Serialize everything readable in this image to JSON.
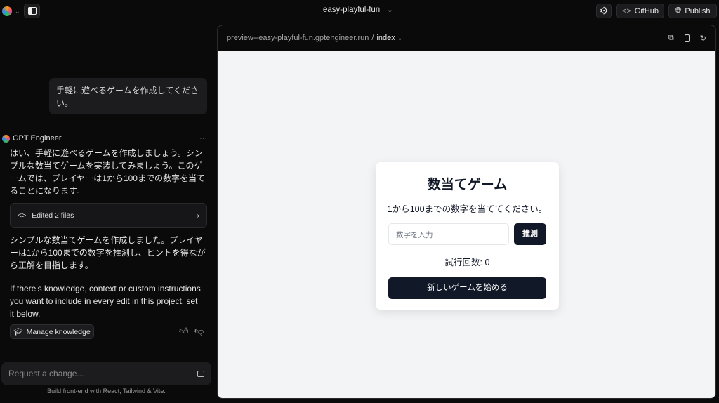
{
  "topbar": {
    "project_name": "easy-playful-fun",
    "github_label": "GitHub",
    "publish_label": "Publish"
  },
  "chat": {
    "user_message": "手軽に遊べるゲームを作成してください。",
    "assistant_name": "GPT Engineer",
    "assistant_intro": "はい、手軽に遊べるゲームを作成しましょう。シンプルな数当てゲームを実装してみましょう。このゲームでは、プレイヤーは1から100までの数字を当てることになります。",
    "edited_label": "Edited 2 files",
    "assistant_summary": "シンプルな数当てゲームを作成しました。プレイヤーは1から100までの数字を推測し、ヒントを得ながら正解を目指します。",
    "knowledge_text": "If there's knowledge, context or custom instructions you want to include in every edit in this project, set it below.",
    "manage_knowledge_label": "Manage knowledge",
    "input_placeholder": "Request a change...",
    "footer_note": "Build front-end with React, Tailwind & Vite."
  },
  "preview": {
    "url": "preview--easy-playful-fun.gptengineer.run",
    "separator": "/",
    "page": "index",
    "game": {
      "title": "数当てゲーム",
      "instructions": "1から100までの数字を当ててください。",
      "input_placeholder": "数字を入力",
      "guess_label": "推測",
      "attempts_label": "試行回数: 0",
      "new_game_label": "新しいゲームを始める"
    }
  }
}
